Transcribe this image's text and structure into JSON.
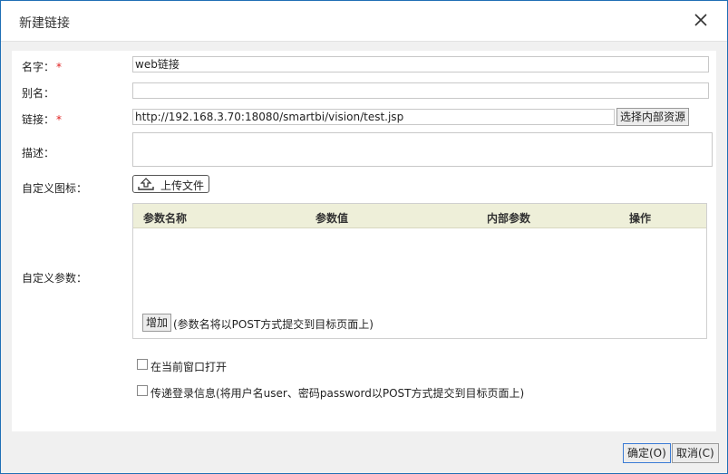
{
  "dialog": {
    "title": "新建链接",
    "close_icon": "close-icon"
  },
  "form": {
    "name_label": "名字：",
    "name_value": "web链接",
    "alias_label": "别名：",
    "alias_value": "",
    "link_label": "链接：",
    "link_value": "http://192.168.3.70:18080/smartbi/vision/test.jsp",
    "select_resource_label": "选择内部资源",
    "desc_label": "描述：",
    "desc_value": "",
    "icon_label": "自定义图标：",
    "upload_label": "上传文件",
    "upload_icon": "upload-icon",
    "params_label": "自定义参数：",
    "required_mark": "*"
  },
  "params_table": {
    "columns": [
      "参数名称",
      "参数值",
      "内部参数",
      "操作"
    ],
    "rows": [],
    "add_label": "增加",
    "hint": "(参数名将以POST方式提交到目标页面上)"
  },
  "options": [
    {
      "label": "在当前窗口打开",
      "checked": false
    },
    {
      "label": "传递登录信息(将用户名user、密码password以POST方式提交到目标页面上)",
      "checked": false
    }
  ],
  "footer": {
    "ok_label": "确定(O)",
    "cancel_label": "取消(C)"
  },
  "colors": {
    "accent": "#1f6fb5",
    "required": "#e02020",
    "table_header_bg": "#eeefd9"
  }
}
